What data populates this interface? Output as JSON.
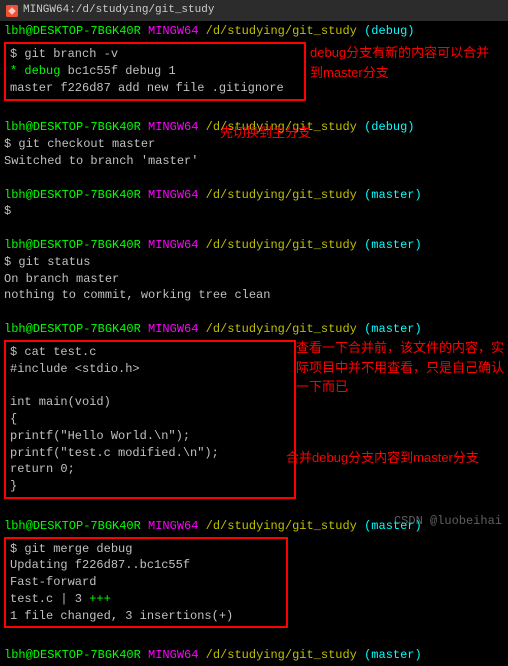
{
  "titlebar": {
    "text": "MINGW64:/d/studying/git_study"
  },
  "prompts": {
    "p1": "lbh@DESKTOP-7BGK40R",
    "mingw": "MINGW64",
    "path": "/d/studying/git_study",
    "branch_debug": "(debug)",
    "branch_master": "(master)"
  },
  "block1": {
    "cmd": "$ git branch -v",
    "line1_star": "*",
    "line1_name": "debug",
    "line1_hash": "bc1c55f debug 1",
    "line2": "  master f226d87 add new file .gitignore"
  },
  "block2": {
    "cmd": "$ git checkout master",
    "out": "Switched to branch 'master'"
  },
  "block3": {
    "cmd": "$"
  },
  "block4": {
    "cmd": "$ git status",
    "out1": "On branch master",
    "out2": "nothing to commit, working tree clean"
  },
  "block5": {
    "cmd": "$ cat test.c",
    "l1": "#include <stdio.h>",
    "l2": "",
    "l3": "int main(void)",
    "l4": "{",
    "l5": "    printf(\"Hello World.\\n\");",
    "l6": "    printf(\"test.c modified.\\n\");",
    "l7": "    return 0;",
    "l8": "}"
  },
  "block6": {
    "cmd": "$ git merge debug",
    "l1": "Updating f226d87..bc1c55f",
    "l2": "Fast-forward",
    "l3a": " test.c | 3 ",
    "l3b": "+++",
    "l4": " 1 file changed, 3 insertions(+)"
  },
  "annotations": {
    "a1": "debug分支有新的内容可以合并到master分支",
    "a2": "先切换到主分支",
    "a3": "查看一下合并前，该文件的内容，实际项目中并不用查看，只是自己确认一下而已",
    "a4": "合并debug分支内容到master分支"
  },
  "watermark": "CSDN @luobeihai"
}
